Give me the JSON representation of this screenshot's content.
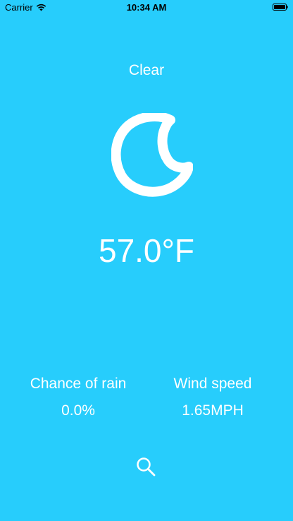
{
  "status_bar": {
    "carrier": "Carrier",
    "time": "10:34 AM"
  },
  "weather": {
    "condition": "Clear",
    "icon": "moon-icon",
    "temperature": "57.0°F"
  },
  "stats": {
    "rain_label": "Chance of rain",
    "rain_value": "0.0%",
    "wind_label": "Wind speed",
    "wind_value": "1.65MPH"
  },
  "actions": {
    "search_icon": "search-icon"
  },
  "colors": {
    "background": "#27cdfc",
    "foreground": "#ffffff"
  }
}
